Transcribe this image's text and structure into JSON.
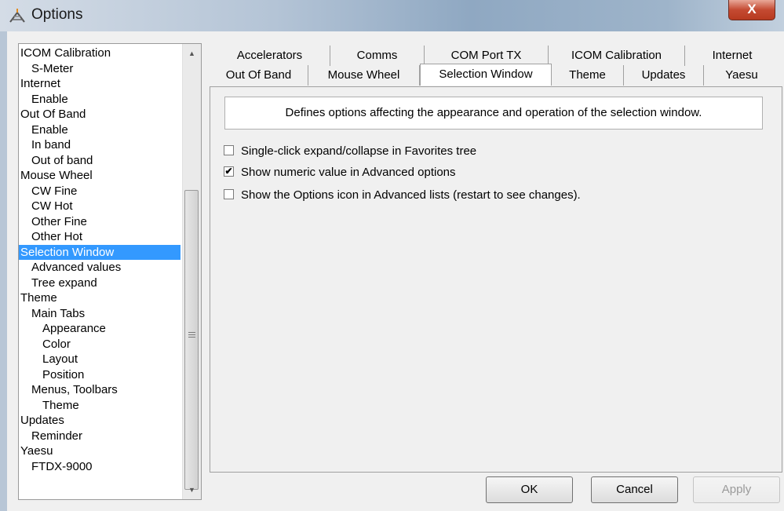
{
  "window": {
    "title": "Options",
    "close_label": "X"
  },
  "tree": {
    "items": [
      {
        "label": "ICOM Calibration",
        "level": 0
      },
      {
        "label": "S-Meter",
        "level": 1
      },
      {
        "label": "Internet",
        "level": 0
      },
      {
        "label": "Enable",
        "level": 1
      },
      {
        "label": "Out Of Band",
        "level": 0
      },
      {
        "label": "Enable",
        "level": 1
      },
      {
        "label": "In band",
        "level": 1
      },
      {
        "label": "Out of band",
        "level": 1
      },
      {
        "label": "Mouse Wheel",
        "level": 0
      },
      {
        "label": "CW Fine",
        "level": 1
      },
      {
        "label": "CW Hot",
        "level": 1
      },
      {
        "label": "Other Fine",
        "level": 1
      },
      {
        "label": "Other Hot",
        "level": 1
      },
      {
        "label": "Selection Window",
        "level": 0,
        "selected": true
      },
      {
        "label": "Advanced values",
        "level": 1
      },
      {
        "label": "Tree expand",
        "level": 1
      },
      {
        "label": "Theme",
        "level": 0
      },
      {
        "label": "Main Tabs",
        "level": 1
      },
      {
        "label": "Appearance",
        "level": 2
      },
      {
        "label": "Color",
        "level": 2
      },
      {
        "label": "Layout",
        "level": 2
      },
      {
        "label": "Position",
        "level": 2
      },
      {
        "label": "Menus, Toolbars",
        "level": 1
      },
      {
        "label": "Theme",
        "level": 2
      },
      {
        "label": "Updates",
        "level": 0
      },
      {
        "label": "Reminder",
        "level": 1
      },
      {
        "label": "Yaesu",
        "level": 0
      },
      {
        "label": "FTDX-9000",
        "level": 1
      }
    ]
  },
  "tabs": {
    "row1": [
      "Accelerators",
      "Comms",
      "COM Port TX",
      "ICOM Calibration",
      "Internet"
    ],
    "row2": [
      "Out Of Band",
      "Mouse Wheel",
      "Selection Window",
      "Theme",
      "Updates",
      "Yaesu"
    ],
    "active": "Selection Window"
  },
  "panel": {
    "description": "Defines options affecting the appearance and operation of the selection window.",
    "options": [
      {
        "label": "Single-click expand/collapse in Favorites tree",
        "checked": false
      },
      {
        "label": "Show numeric value in Advanced options",
        "checked": true
      },
      {
        "label": "Show the Options icon in Advanced lists (restart to see changes).",
        "checked": false
      }
    ]
  },
  "buttons": {
    "ok": "OK",
    "cancel": "Cancel",
    "apply": "Apply"
  }
}
